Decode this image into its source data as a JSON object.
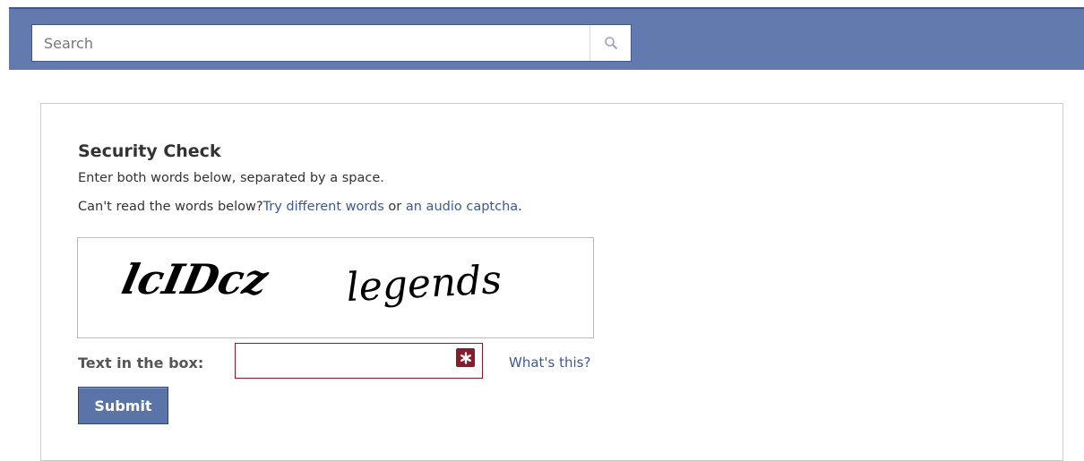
{
  "search": {
    "placeholder": "Search",
    "icon": "magnifier-icon"
  },
  "security": {
    "title": "Security Check",
    "instruction": "Enter both words below, separated by a space.",
    "help_prefix": "Can't read the words below?",
    "different_words_link": "Try different words",
    "or_text": " or ",
    "audio_link": "an audio captcha",
    "period": ".",
    "captcha_words": [
      "lcIDcz",
      "legends"
    ],
    "field_label": "Text in the box:",
    "field_value": "",
    "whats_this": "What's this?",
    "submit_label": "Submit",
    "required_icon": "asterisk-icon"
  },
  "colors": {
    "topbar": "#627aad",
    "link": "#3b5998",
    "error_border": "#8b1a2a",
    "submit_bg": "#5b74a8"
  }
}
